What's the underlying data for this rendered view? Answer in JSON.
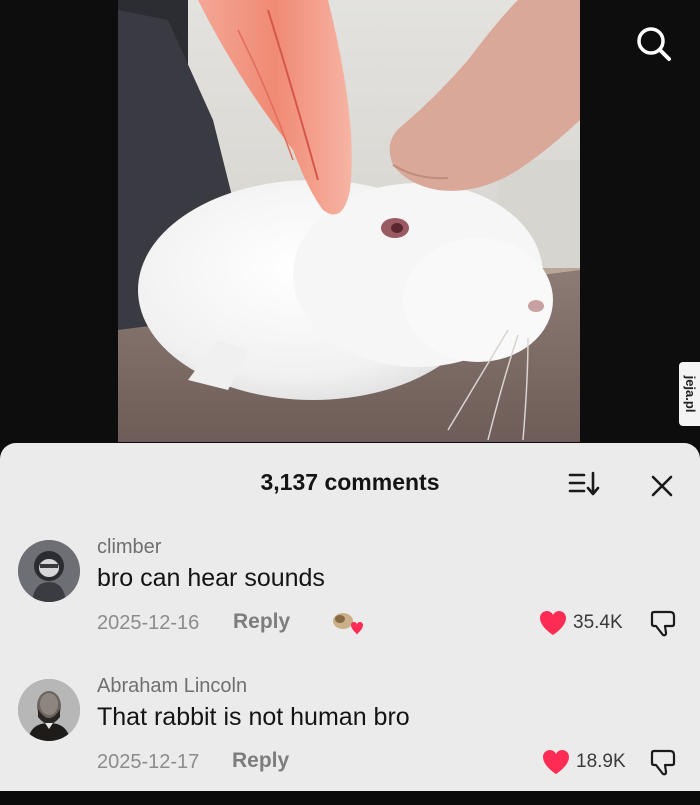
{
  "watermark": {
    "text": "jeja.pl"
  },
  "search": {
    "icon": "search-icon"
  },
  "comments_panel": {
    "count_label": "3,137 comments",
    "comments": [
      {
        "username": "climber",
        "text": "bro can hear sounds",
        "date": "2025-12-16",
        "reply_label": "Reply",
        "likes": "35.4K",
        "has_sticker": true
      },
      {
        "username": "Abraham Lincoln",
        "text": "That rabbit is not human bro",
        "date": "2025-12-17",
        "reply_label": "Reply",
        "likes": "18.9K",
        "has_sticker": false
      }
    ]
  },
  "colors": {
    "like_heart": "#fe2c55",
    "sheet_bg": "#ebebeb",
    "video_bg": "#0d0d0d"
  }
}
